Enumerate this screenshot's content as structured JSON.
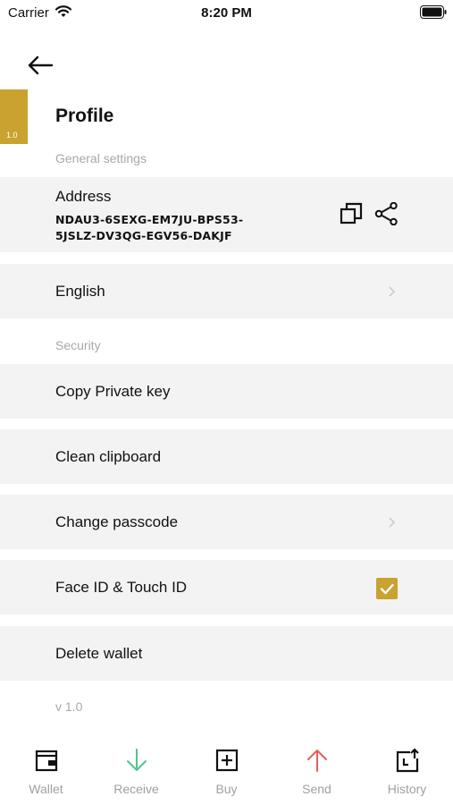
{
  "status_bar": {
    "carrier": "Carrier",
    "time": "8:20 PM"
  },
  "version_badge": "1.0",
  "header": {
    "title": "Profile"
  },
  "sections": {
    "general": "General settings",
    "security": "Security"
  },
  "address": {
    "label": "Address",
    "line1": "NDAU3-6SEXG-EM7JU-BPS53-",
    "line2": "5JSLZ-DV3QG-EGV56-DAKJF"
  },
  "language": {
    "label": "English"
  },
  "security_items": {
    "copy_private_key": "Copy Private key",
    "clean_clipboard": "Clean clipboard",
    "change_passcode": "Change passcode",
    "face_id": "Face ID & Touch ID",
    "delete_wallet": "Delete wallet"
  },
  "face_id_enabled": true,
  "version_text": "v 1.0",
  "tabbar": {
    "wallet": "Wallet",
    "receive": "Receive",
    "buy": "Buy",
    "send": "Send",
    "history": "History"
  },
  "colors": {
    "accent": "#c9a230",
    "receive": "#52c48a",
    "send": "#e0605a",
    "row_bg": "#f3f3f3"
  }
}
